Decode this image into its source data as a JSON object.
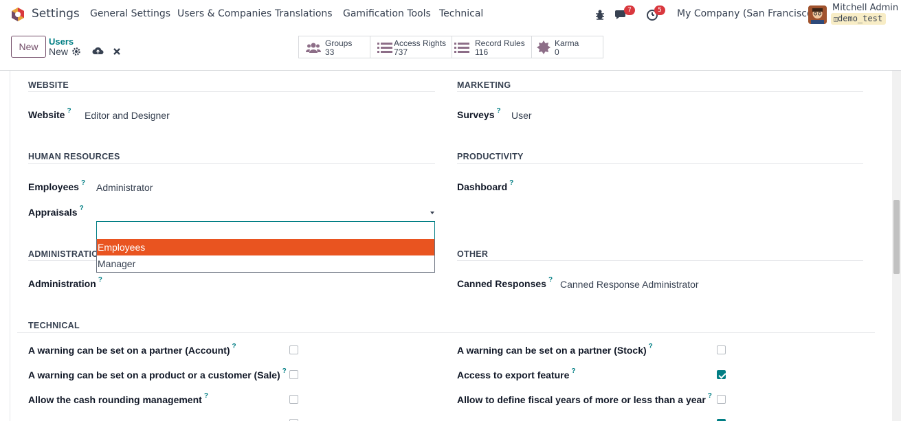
{
  "nav": {
    "app_title": "Settings",
    "menu": [
      "General Settings",
      "Users & Companies",
      "Translations",
      "Gamification Tools",
      "Technical"
    ],
    "chat_badge": "7",
    "activity_badge": "5",
    "company": "My Company (San Francisco)",
    "user_name": "Mitchell Admin",
    "db_name": "demo_test"
  },
  "control": {
    "new_label": "New",
    "breadcrumb_parent": "Users",
    "breadcrumb_current": "New",
    "stats": [
      {
        "label": "Groups",
        "value": "33",
        "icon": "users-icon"
      },
      {
        "label": "Access Rights",
        "value": "737",
        "icon": "list-icon"
      },
      {
        "label": "Record Rules",
        "value": "116",
        "icon": "list-icon"
      },
      {
        "label": "Karma",
        "value": "0",
        "icon": "badge-icon"
      }
    ]
  },
  "form": {
    "website": {
      "title": "WEBSITE",
      "label": "Website",
      "value": "Editor and Designer"
    },
    "marketing": {
      "title": "MARKETING",
      "label": "Surveys",
      "value": "User"
    },
    "hr": {
      "title": "HUMAN RESOURCES",
      "employees_label": "Employees",
      "employees_value": "Administrator",
      "appraisals_label": "Appraisals",
      "appraisals_value": ""
    },
    "productivity": {
      "title": "PRODUCTIVITY",
      "label": "Dashboard",
      "value": ""
    },
    "administration": {
      "title": "ADMINISTRATIC",
      "label": "Administration",
      "value": ""
    },
    "other": {
      "title": "OTHER",
      "label": "Canned Responses",
      "value": "Canned Response Administrator"
    },
    "technical": {
      "title": "TECHNICAL",
      "left": [
        {
          "label": "A warning can be set on a partner (Account)",
          "checked": false
        },
        {
          "label": "A warning can be set on a product or a customer (Sale)",
          "checked": false
        },
        {
          "label": "Allow the cash rounding management",
          "checked": false
        }
      ],
      "right": [
        {
          "label": "A warning can be set on a partner (Stock)",
          "checked": false
        },
        {
          "label": "Access to export feature",
          "checked": true
        },
        {
          "label": "Allow to define fiscal years of more or less than a year",
          "checked": false
        }
      ]
    },
    "help_mark": "?"
  },
  "dropdown": {
    "options": [
      "Employees",
      "Manager"
    ],
    "active_index": 0
  },
  "colors": {
    "brand": "#714b67",
    "accent": "#017e84",
    "highlight": "#e95420",
    "badge": "#d9383e"
  }
}
